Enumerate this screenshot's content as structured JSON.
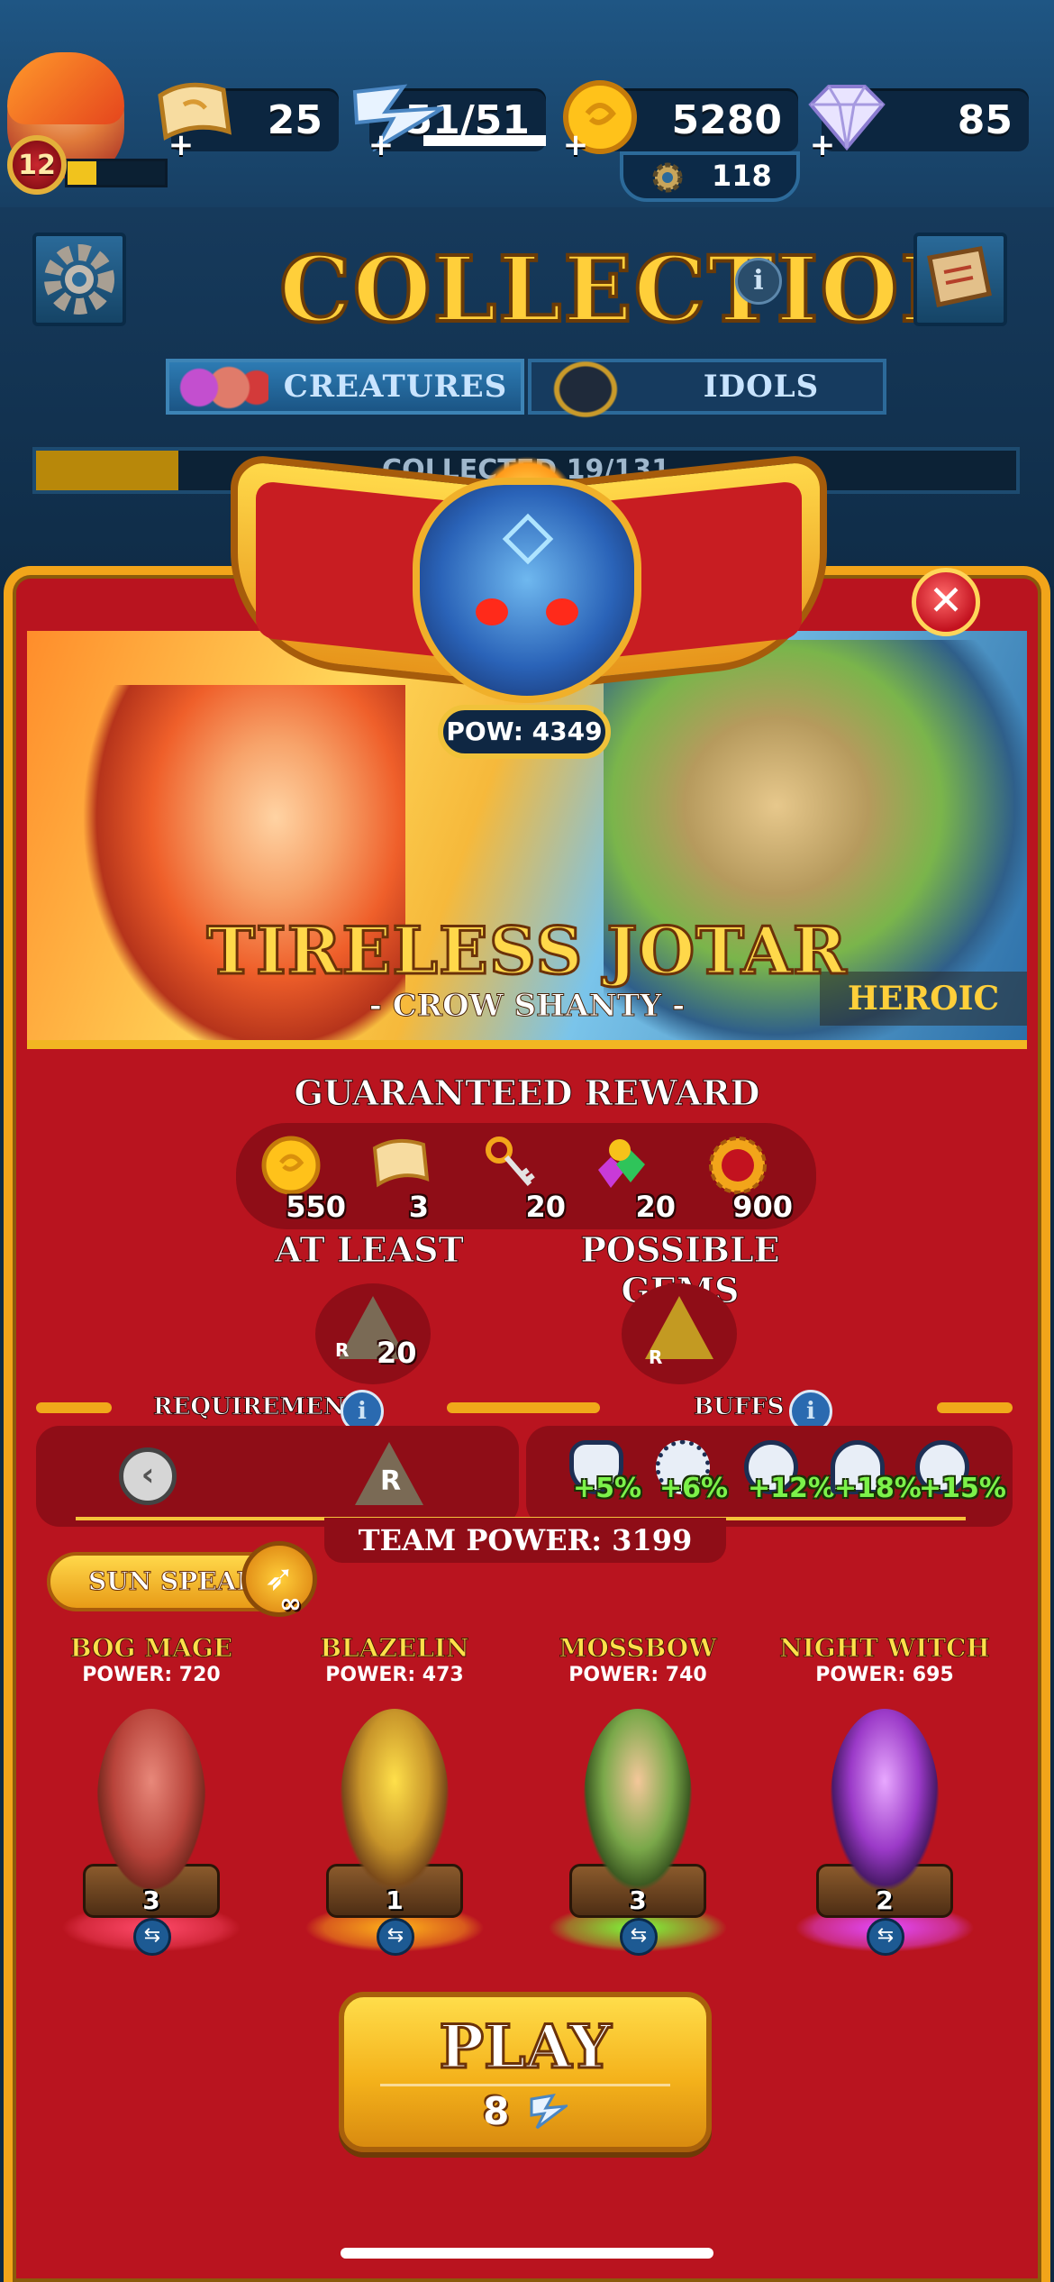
{
  "player": {
    "level": "12",
    "xp_progress": 0.3
  },
  "resources": {
    "scrolls": "25",
    "energy": "51/51",
    "gold": "5280",
    "gems": "85",
    "gears": "118"
  },
  "collection": {
    "title": "COLLECTION",
    "info_icon": "i",
    "tabs": [
      {
        "label": "CREATURES",
        "active": true
      },
      {
        "label": "IDOLS",
        "active": false
      }
    ],
    "collected_label": "COLLECTED 19/131",
    "collected_progress": 0.145
  },
  "modal": {
    "close_glyph": "✕",
    "pow": "POW: 4349",
    "level_title": "TIRELESS JOTAR",
    "level_subtitle": "- CROW SHANTY -",
    "difficulty": "HEROIC",
    "guaranteed_heading": "GUARANTEED REWARD",
    "rewards": [
      {
        "icon": "gold-coin-icon",
        "qty": "550"
      },
      {
        "icon": "scroll-icon",
        "qty": "3"
      },
      {
        "icon": "key-icon",
        "qty": "20"
      },
      {
        "icon": "gem-bundle-icon",
        "qty": "20"
      },
      {
        "icon": "sun-token-icon",
        "qty": "900"
      }
    ],
    "at_least_heading": "AT LEAST",
    "possible_gems_heading": "POSSIBLE GEMS",
    "at_least_gem": {
      "rarity": "R",
      "qty": "20"
    },
    "possible_gem": {
      "rarity": "R"
    },
    "requirements_heading": "REQUIREMENTS",
    "buffs_heading": "BUFFS",
    "requirement_gem": "R",
    "back_glyph": "‹",
    "buffs": [
      {
        "icon": "shield-icon",
        "pct": "+5%"
      },
      {
        "icon": "gear-burst-icon",
        "pct": "+6%"
      },
      {
        "icon": "spiral-icon",
        "pct": "+12%"
      },
      {
        "icon": "heart-shield-icon",
        "pct": "+18%"
      },
      {
        "icon": "swirl-icon",
        "pct": "+15%"
      }
    ],
    "team_power": "TEAM POWER: 3199",
    "weapon": {
      "name": "SUN SPEAR",
      "uses": "∞"
    },
    "creatures": [
      {
        "name": "BOG MAGE",
        "power": "POWER: 720",
        "level": "3",
        "color": "#ff4a6a"
      },
      {
        "name": "BLAZELIN",
        "power": "POWER: 473",
        "level": "1",
        "color": "#ffb31a"
      },
      {
        "name": "MOSSBOW",
        "power": "POWER: 740",
        "level": "3",
        "color": "#7bff3a"
      },
      {
        "name": "NIGHT WITCH",
        "power": "POWER: 695",
        "level": "2",
        "color": "#e24aff"
      }
    ],
    "play_label": "PLAY",
    "play_cost": "8"
  },
  "colors": {
    "modal_red": "#b9141f",
    "gold_border": "#f2a51a",
    "top_blue": "#1f5684"
  }
}
